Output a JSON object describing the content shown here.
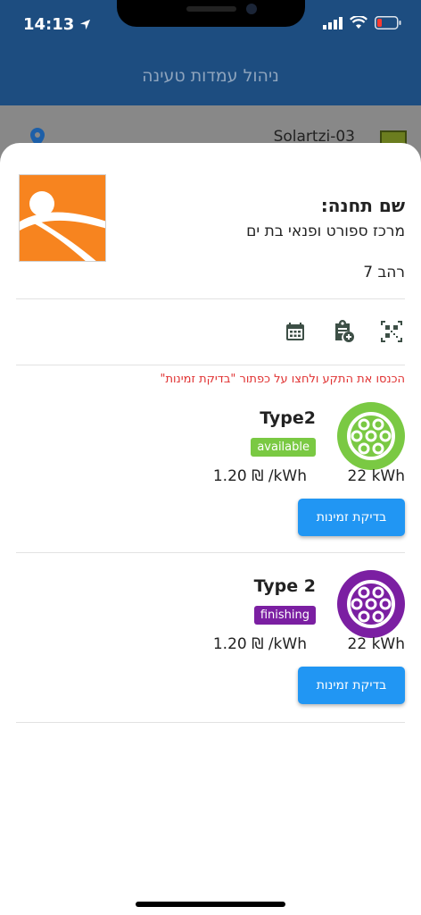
{
  "status_bar": {
    "time": "14:13"
  },
  "app": {
    "title": "ניהול עמדות טעינה"
  },
  "background_list": {
    "item_label": "Solartzi-03"
  },
  "station": {
    "heading": "שם תחנה:",
    "name": "מרכז ספורט ופנאי בת ים",
    "address": "רהב 7",
    "actions": [
      "calendar-icon",
      "clipboard-add-icon",
      "qr-code-icon"
    ],
    "hint": "הכנסו את התקע ולחצו על כפתור \"בדיקת זמינות\""
  },
  "connectors": [
    {
      "type": "Type2",
      "status": "available",
      "status_color": "#7ac943",
      "icon_color": "#7ac943",
      "power": "22 kWh",
      "price": "1.20 ₪ /kWh",
      "button_label": "בדיקת זמינות"
    },
    {
      "type": "Type 2",
      "status": "finishing",
      "status_color": "#7b1fa2",
      "icon_color": "#7b1fa2",
      "power": "22 kWh",
      "price": "1.20 ₪ /kWh",
      "button_label": "בדיקת זמינות"
    }
  ],
  "colors": {
    "header": "#1d4d80",
    "accent_button": "#2196f3",
    "hint_text": "#e03131",
    "logo": "#f7841f"
  }
}
